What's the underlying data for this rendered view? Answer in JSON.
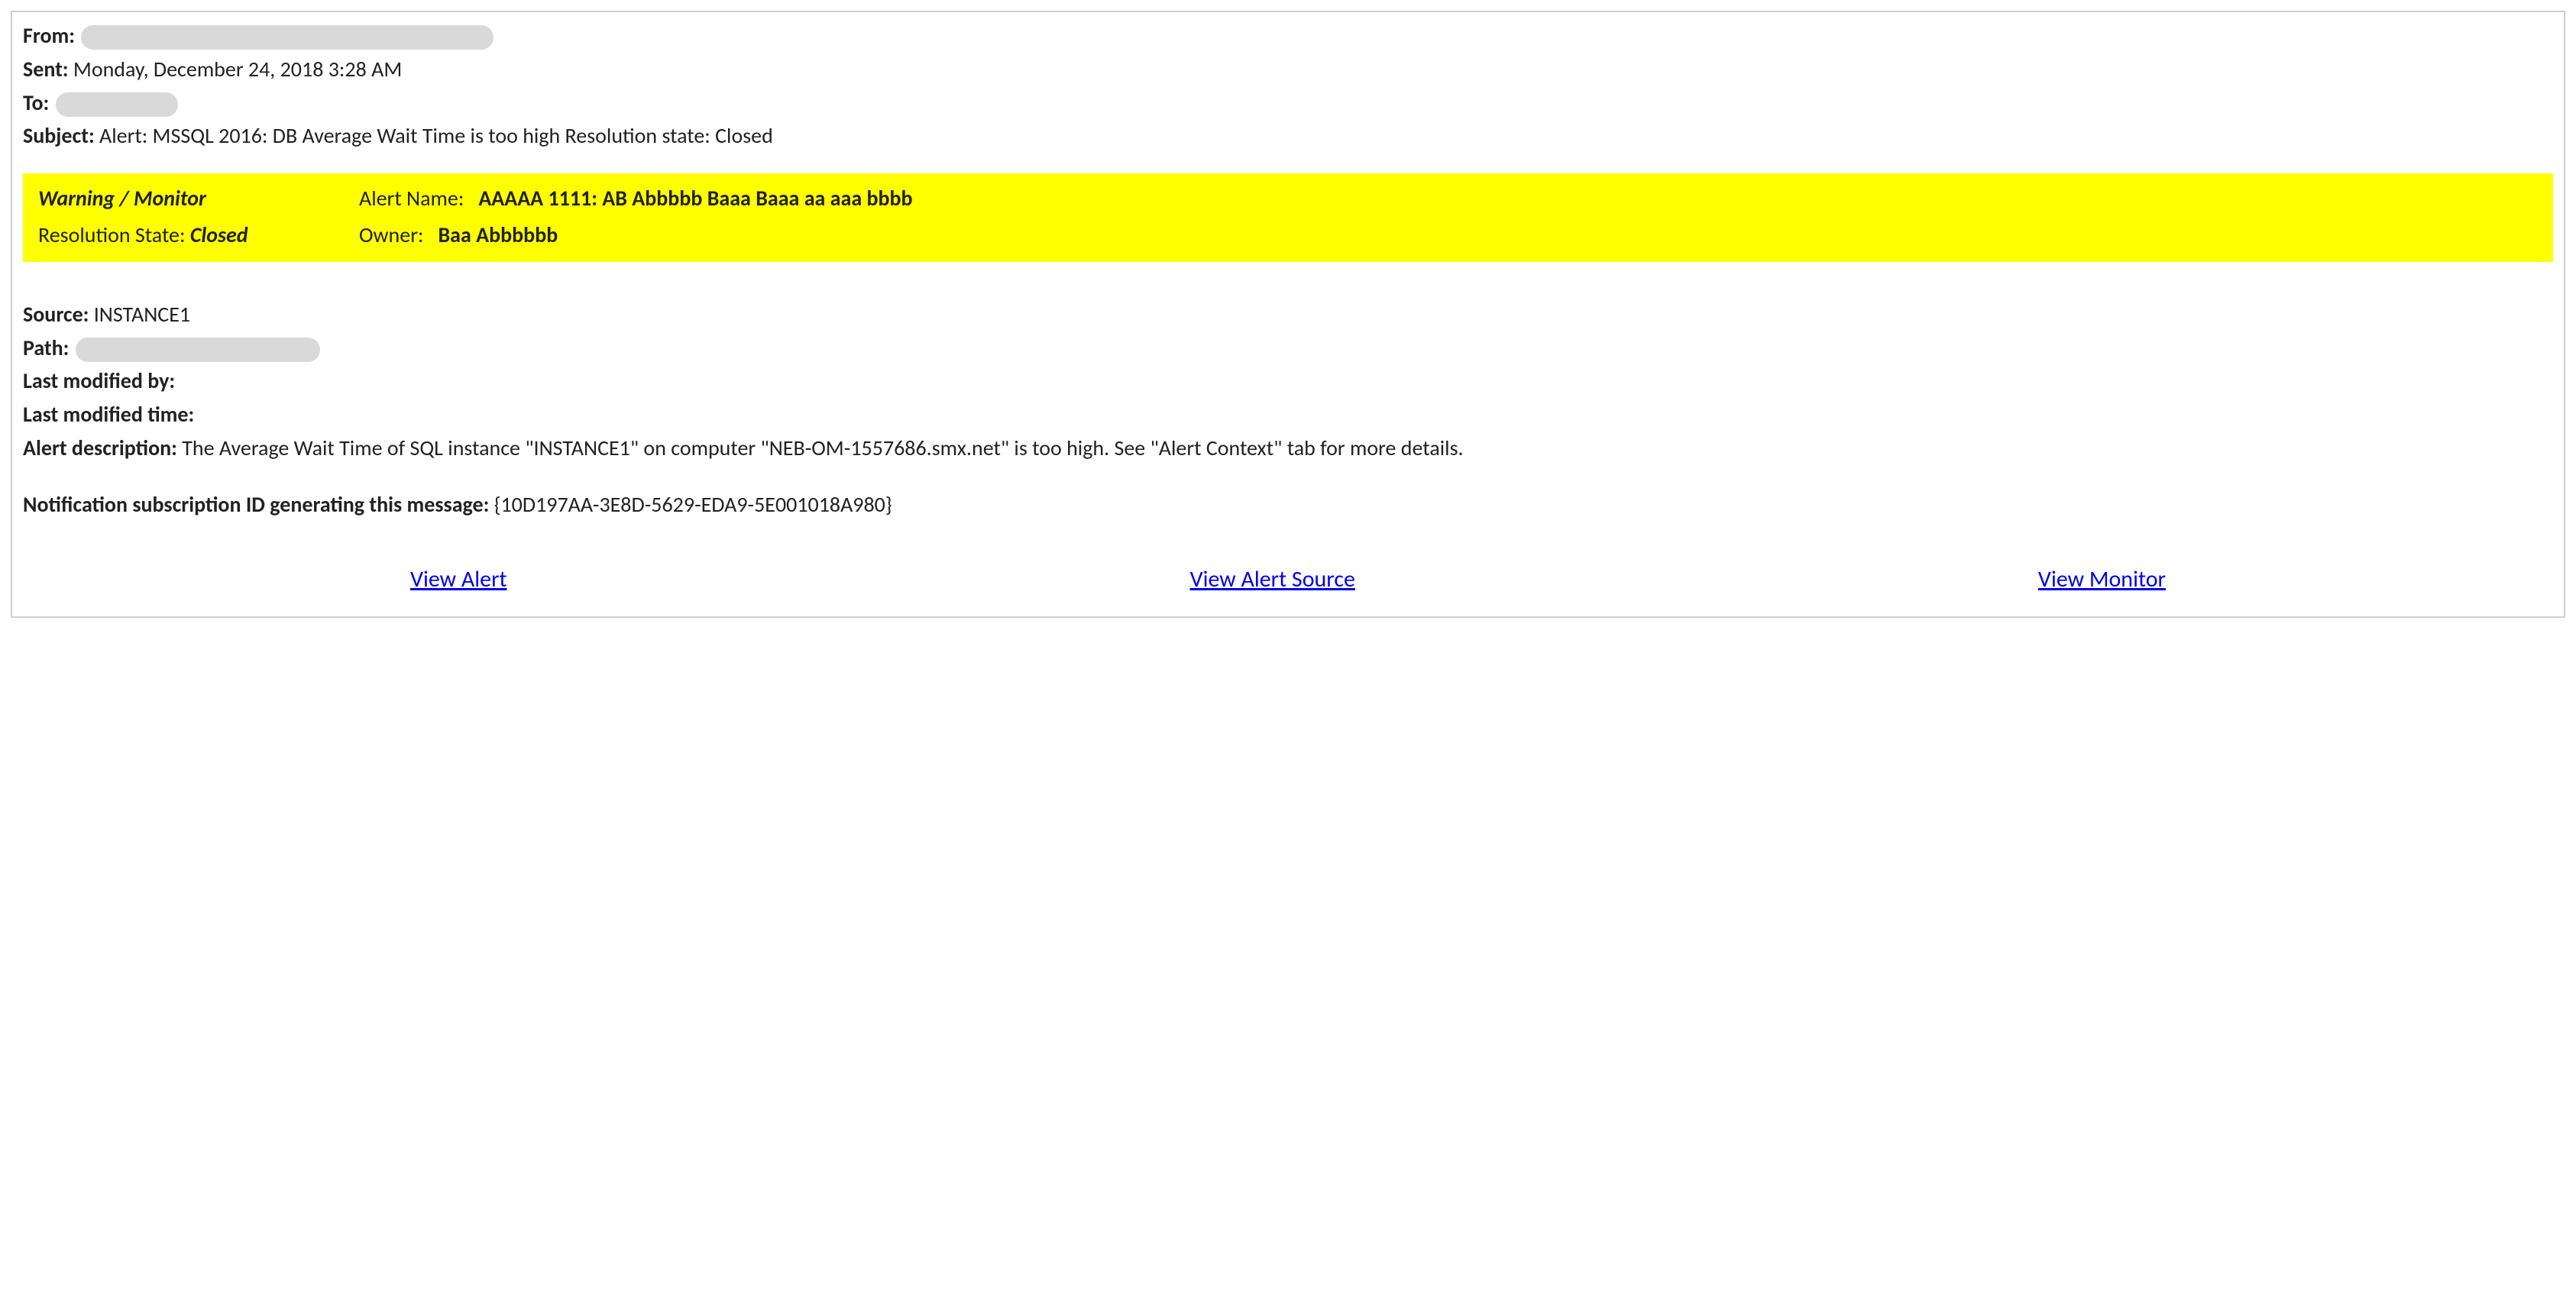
{
  "header": {
    "from_label": "From:",
    "sent_label": "Sent:",
    "sent_value": "Monday, December 24, 2018 3:28 AM",
    "to_label": "To:",
    "subject_label": "Subject:",
    "subject_value": "Alert: MSSQL 2016: DB Average Wait Time is too high Resolution state: Closed"
  },
  "band": {
    "warning_text": "Warning / Monitor",
    "alert_name_label": "Alert Name:",
    "alert_name_value": "AAAAA 1111: AB Abbbbb Baaa Baaa aa aaa bbbb",
    "resolution_label": "Resolution State:",
    "resolution_value": "Closed",
    "owner_label": "Owner:",
    "owner_value": "Baa Abbbbbb"
  },
  "body": {
    "source_label": "Source:",
    "source_value": "INSTANCE1",
    "path_label": "Path:",
    "last_modified_by_label": "Last modified by:",
    "last_modified_time_label": "Last modified time:",
    "alert_desc_label": "Alert description:",
    "alert_desc_value": "The Average Wait Time of SQL instance \"INSTANCE1\" on computer \"NEB-OM-1557686.smx.net\" is too high. See \"Alert Context\" tab for more details.",
    "notif_label": "Notification subscription ID generating this message:",
    "notif_value": "{10D197AA-3E8D-5629-EDA9-5E001018A980}"
  },
  "links": {
    "view_alert": "View Alert",
    "view_alert_source": "View Alert Source",
    "view_monitor": "View Monitor"
  }
}
